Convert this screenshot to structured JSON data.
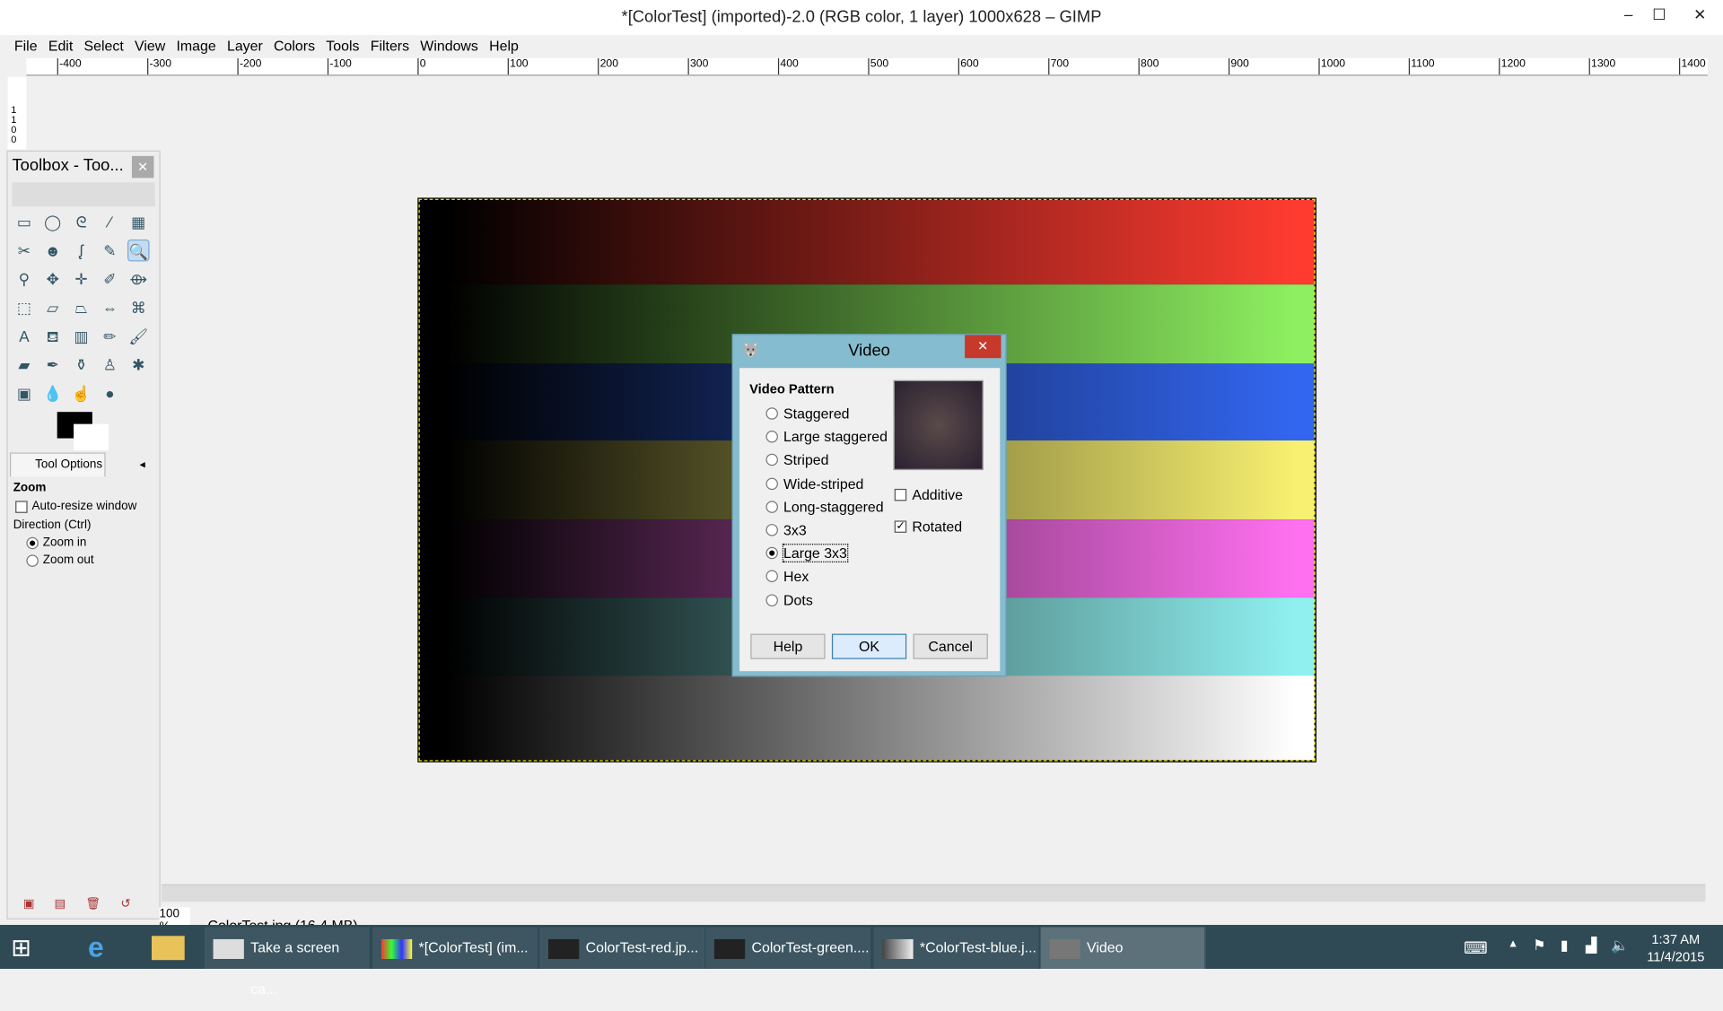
{
  "window": {
    "title": "*[ColorTest] (imported)-2.0 (RGB color, 1 layer) 1000x628 – GIMP",
    "minimize": "–",
    "maximize": "☐",
    "close": "✕"
  },
  "menu": [
    "File",
    "Edit",
    "Select",
    "View",
    "Image",
    "Layer",
    "Colors",
    "Tools",
    "Filters",
    "Windows",
    "Help"
  ],
  "ruler": {
    "h_labels": [
      "-400",
      "-300",
      "-200",
      "-100",
      "0",
      "100",
      "200",
      "300",
      "400",
      "500",
      "600",
      "700",
      "800",
      "900",
      "1000",
      "1100",
      "1200",
      "1300",
      "1400"
    ],
    "v_labels": [
      "1",
      "1",
      "0",
      "0"
    ]
  },
  "image": {
    "bands": [
      "#ff3b30",
      "#8ef060",
      "#3366f0",
      "#f8f070",
      "#ff70f0",
      "#90f0f0",
      "#ffffff"
    ]
  },
  "toolbox": {
    "title": "Toolbox - Too...",
    "close": "✕",
    "tool_options_tab": "Tool Options",
    "zoom_heading": "Zoom",
    "auto_resize": "Auto-resize window",
    "auto_resize_checked": false,
    "direction_label": "Direction  (Ctrl)",
    "zoom_in": "Zoom in",
    "zoom_out": "Zoom out",
    "direction_selected": "Zoom in"
  },
  "status": {
    "zoom": "100 %",
    "file": "ColorTest.jpg (16.4 MB)"
  },
  "dialog": {
    "title": "Video",
    "close": "✕",
    "section": "Video Pattern",
    "patterns": [
      "Staggered",
      "Large staggered",
      "Striped",
      "Wide-striped",
      "Long-staggered",
      "3x3",
      "Large 3x3",
      "Hex",
      "Dots"
    ],
    "selected": "Large 3x3",
    "additive": "Additive",
    "additive_checked": false,
    "rotated": "Rotated",
    "rotated_checked": true,
    "help": "Help",
    "ok": "OK",
    "cancel": "Cancel"
  },
  "taskbar": {
    "items": [
      "Take a screen ca...",
      "*[ColorTest] (im...",
      "ColorTest-red.jp...",
      "ColorTest-green....",
      "*ColorTest-blue.j...",
      "Video"
    ],
    "time": "1:37 AM",
    "date": "11/4/2015"
  }
}
